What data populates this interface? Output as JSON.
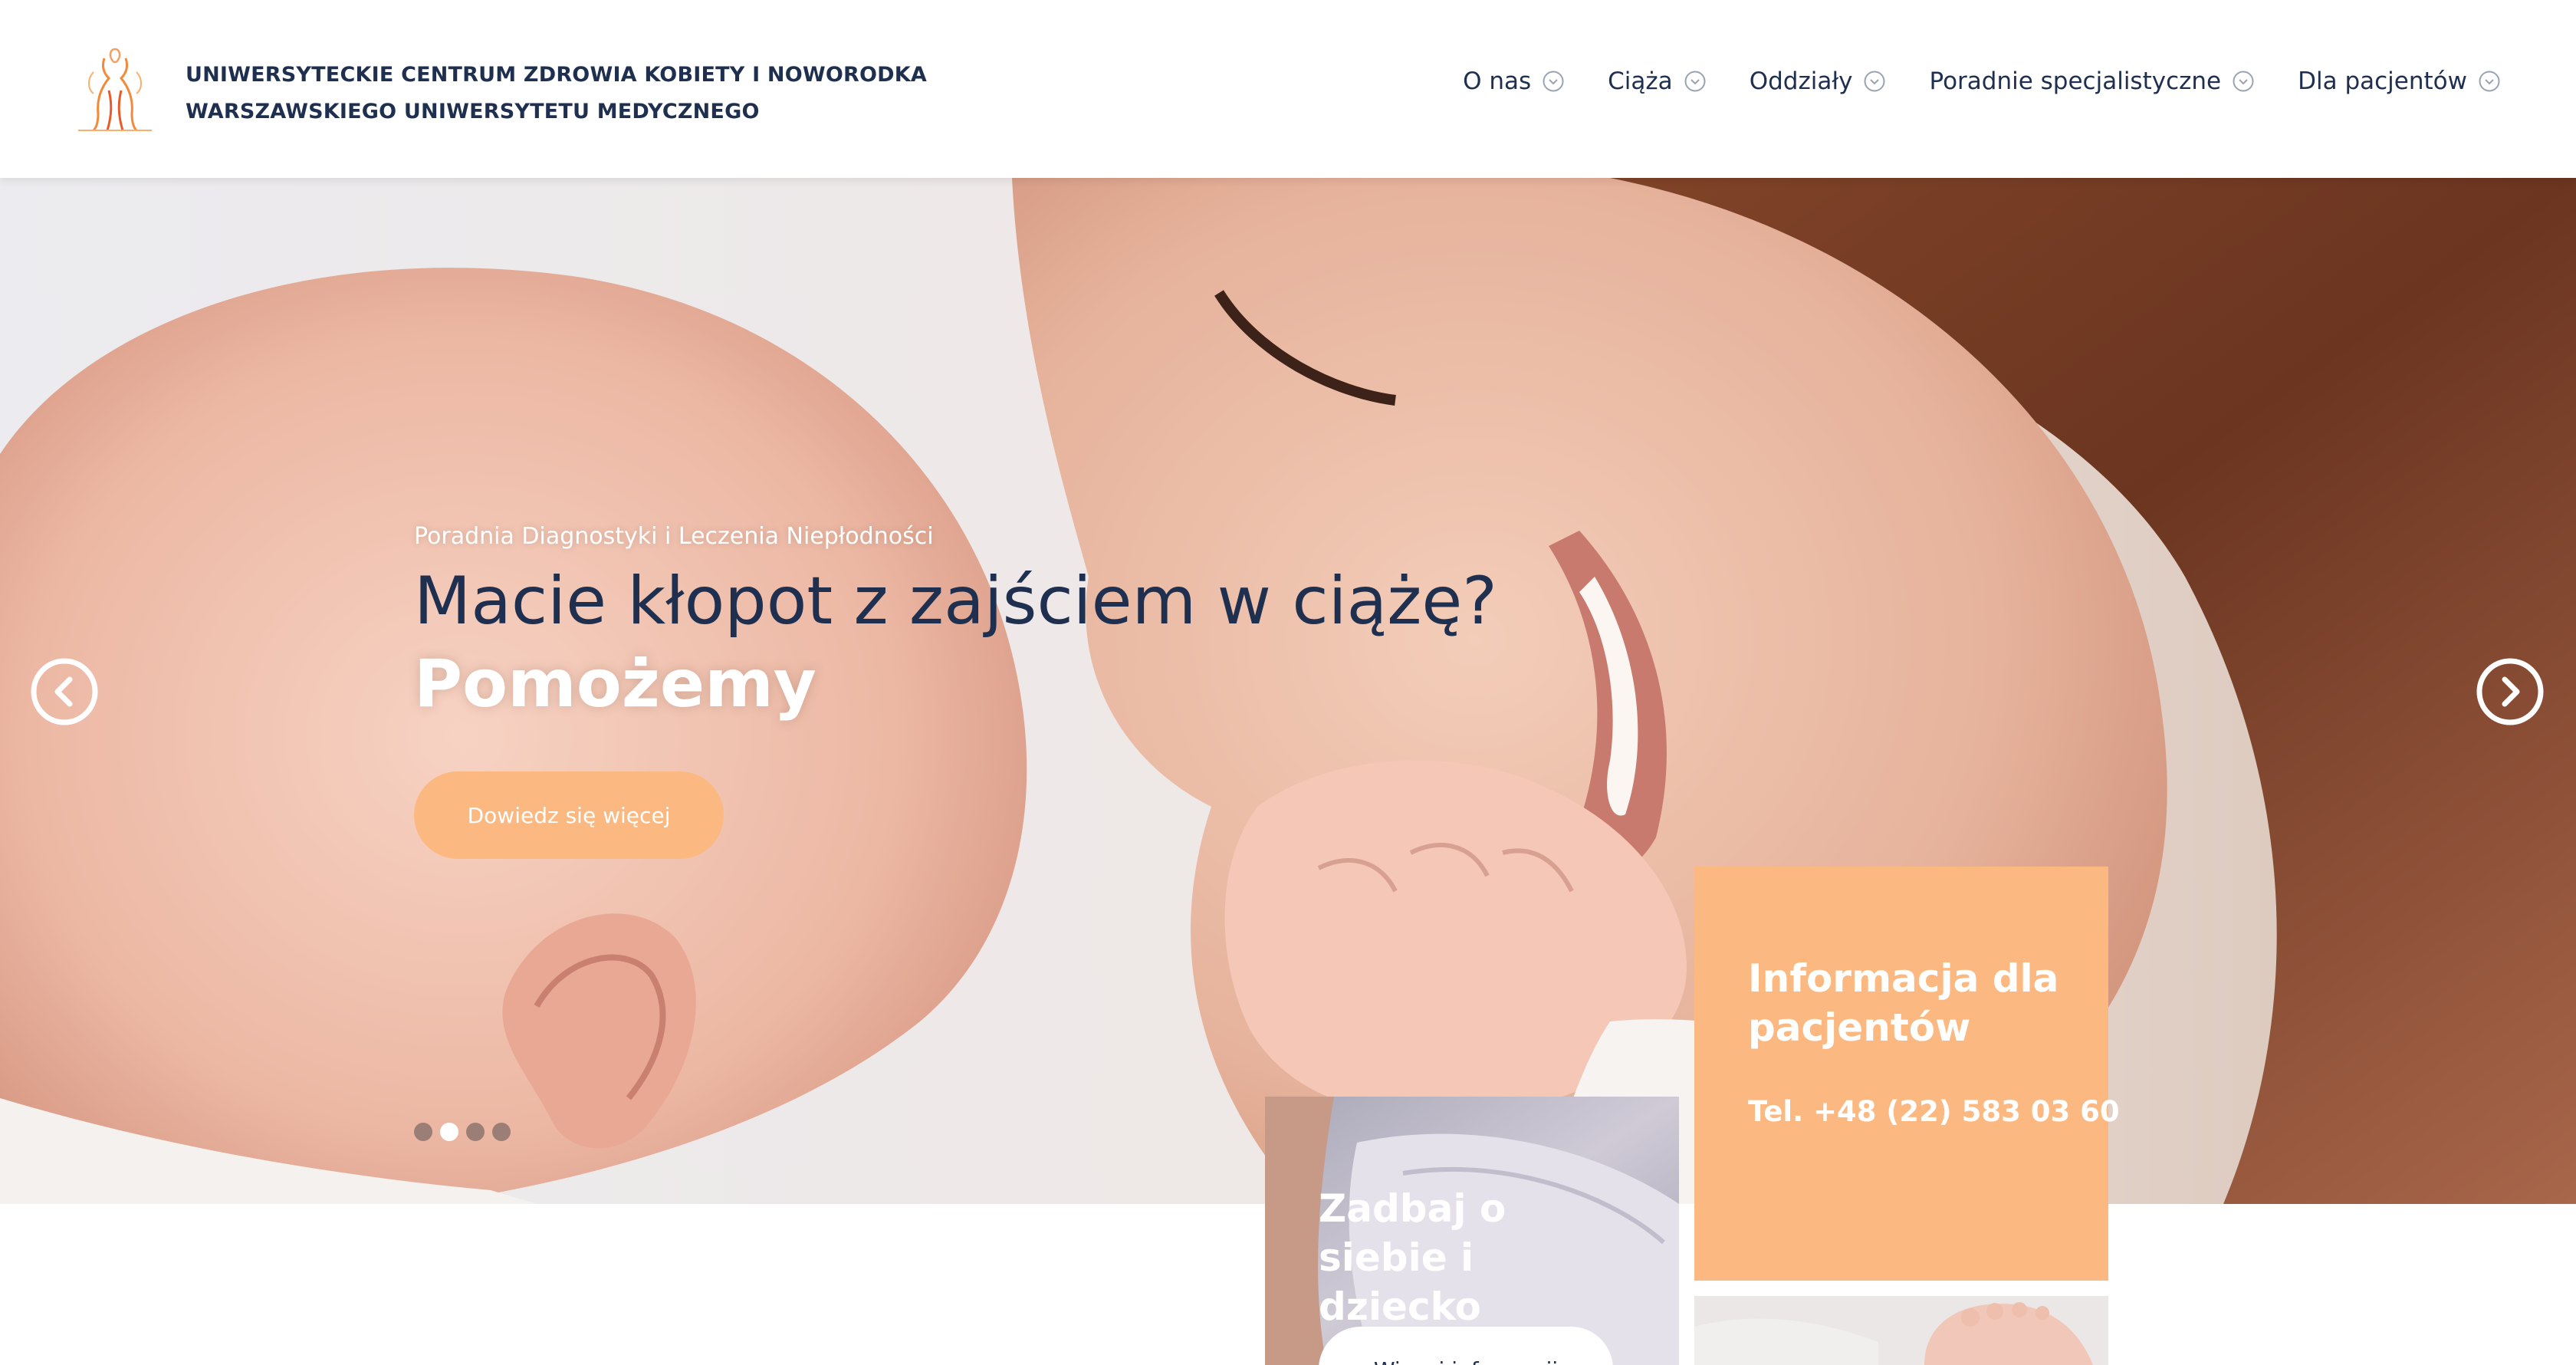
{
  "header": {
    "logo_line1": "UNIWERSYTECKIE CENTRUM ZDROWIA KOBIETY I NOWORODKA",
    "logo_line2": "WARSZAWSKIEGO UNIWERSYTETU MEDYCZNEGO",
    "nav": [
      {
        "label": "O nas"
      },
      {
        "label": "Ciąża"
      },
      {
        "label": "Oddziały"
      },
      {
        "label": "Poradnie specjalistyczne"
      },
      {
        "label": "Dla pacjentów"
      }
    ]
  },
  "hero": {
    "subtitle": "Poradnia Diagnostyki i Leczenia Niepłodności",
    "title": "Macie kłopot z zajściem w ciążę?",
    "title_strong": "Pomożemy",
    "cta_label": "Dowiedz się więcej",
    "slides_total": 4,
    "active_slide": 2
  },
  "cards": {
    "info": {
      "title": "Informacja dla pacjentów",
      "phone": "Tel. +48 (22) 583 03 60"
    },
    "care": {
      "title": "Zadbaj o siebie i dziecko",
      "button_label": "Więcej informacji"
    }
  },
  "colors": {
    "navy": "#1e2f4f",
    "peach": "#fbb981",
    "white": "#ffffff"
  },
  "icons": {
    "logo": "woman-silhouette-logo",
    "nav_chevron": "chevron-down-circle-icon",
    "prev": "arrow-left-circle-icon",
    "next": "arrow-right-circle-icon"
  }
}
